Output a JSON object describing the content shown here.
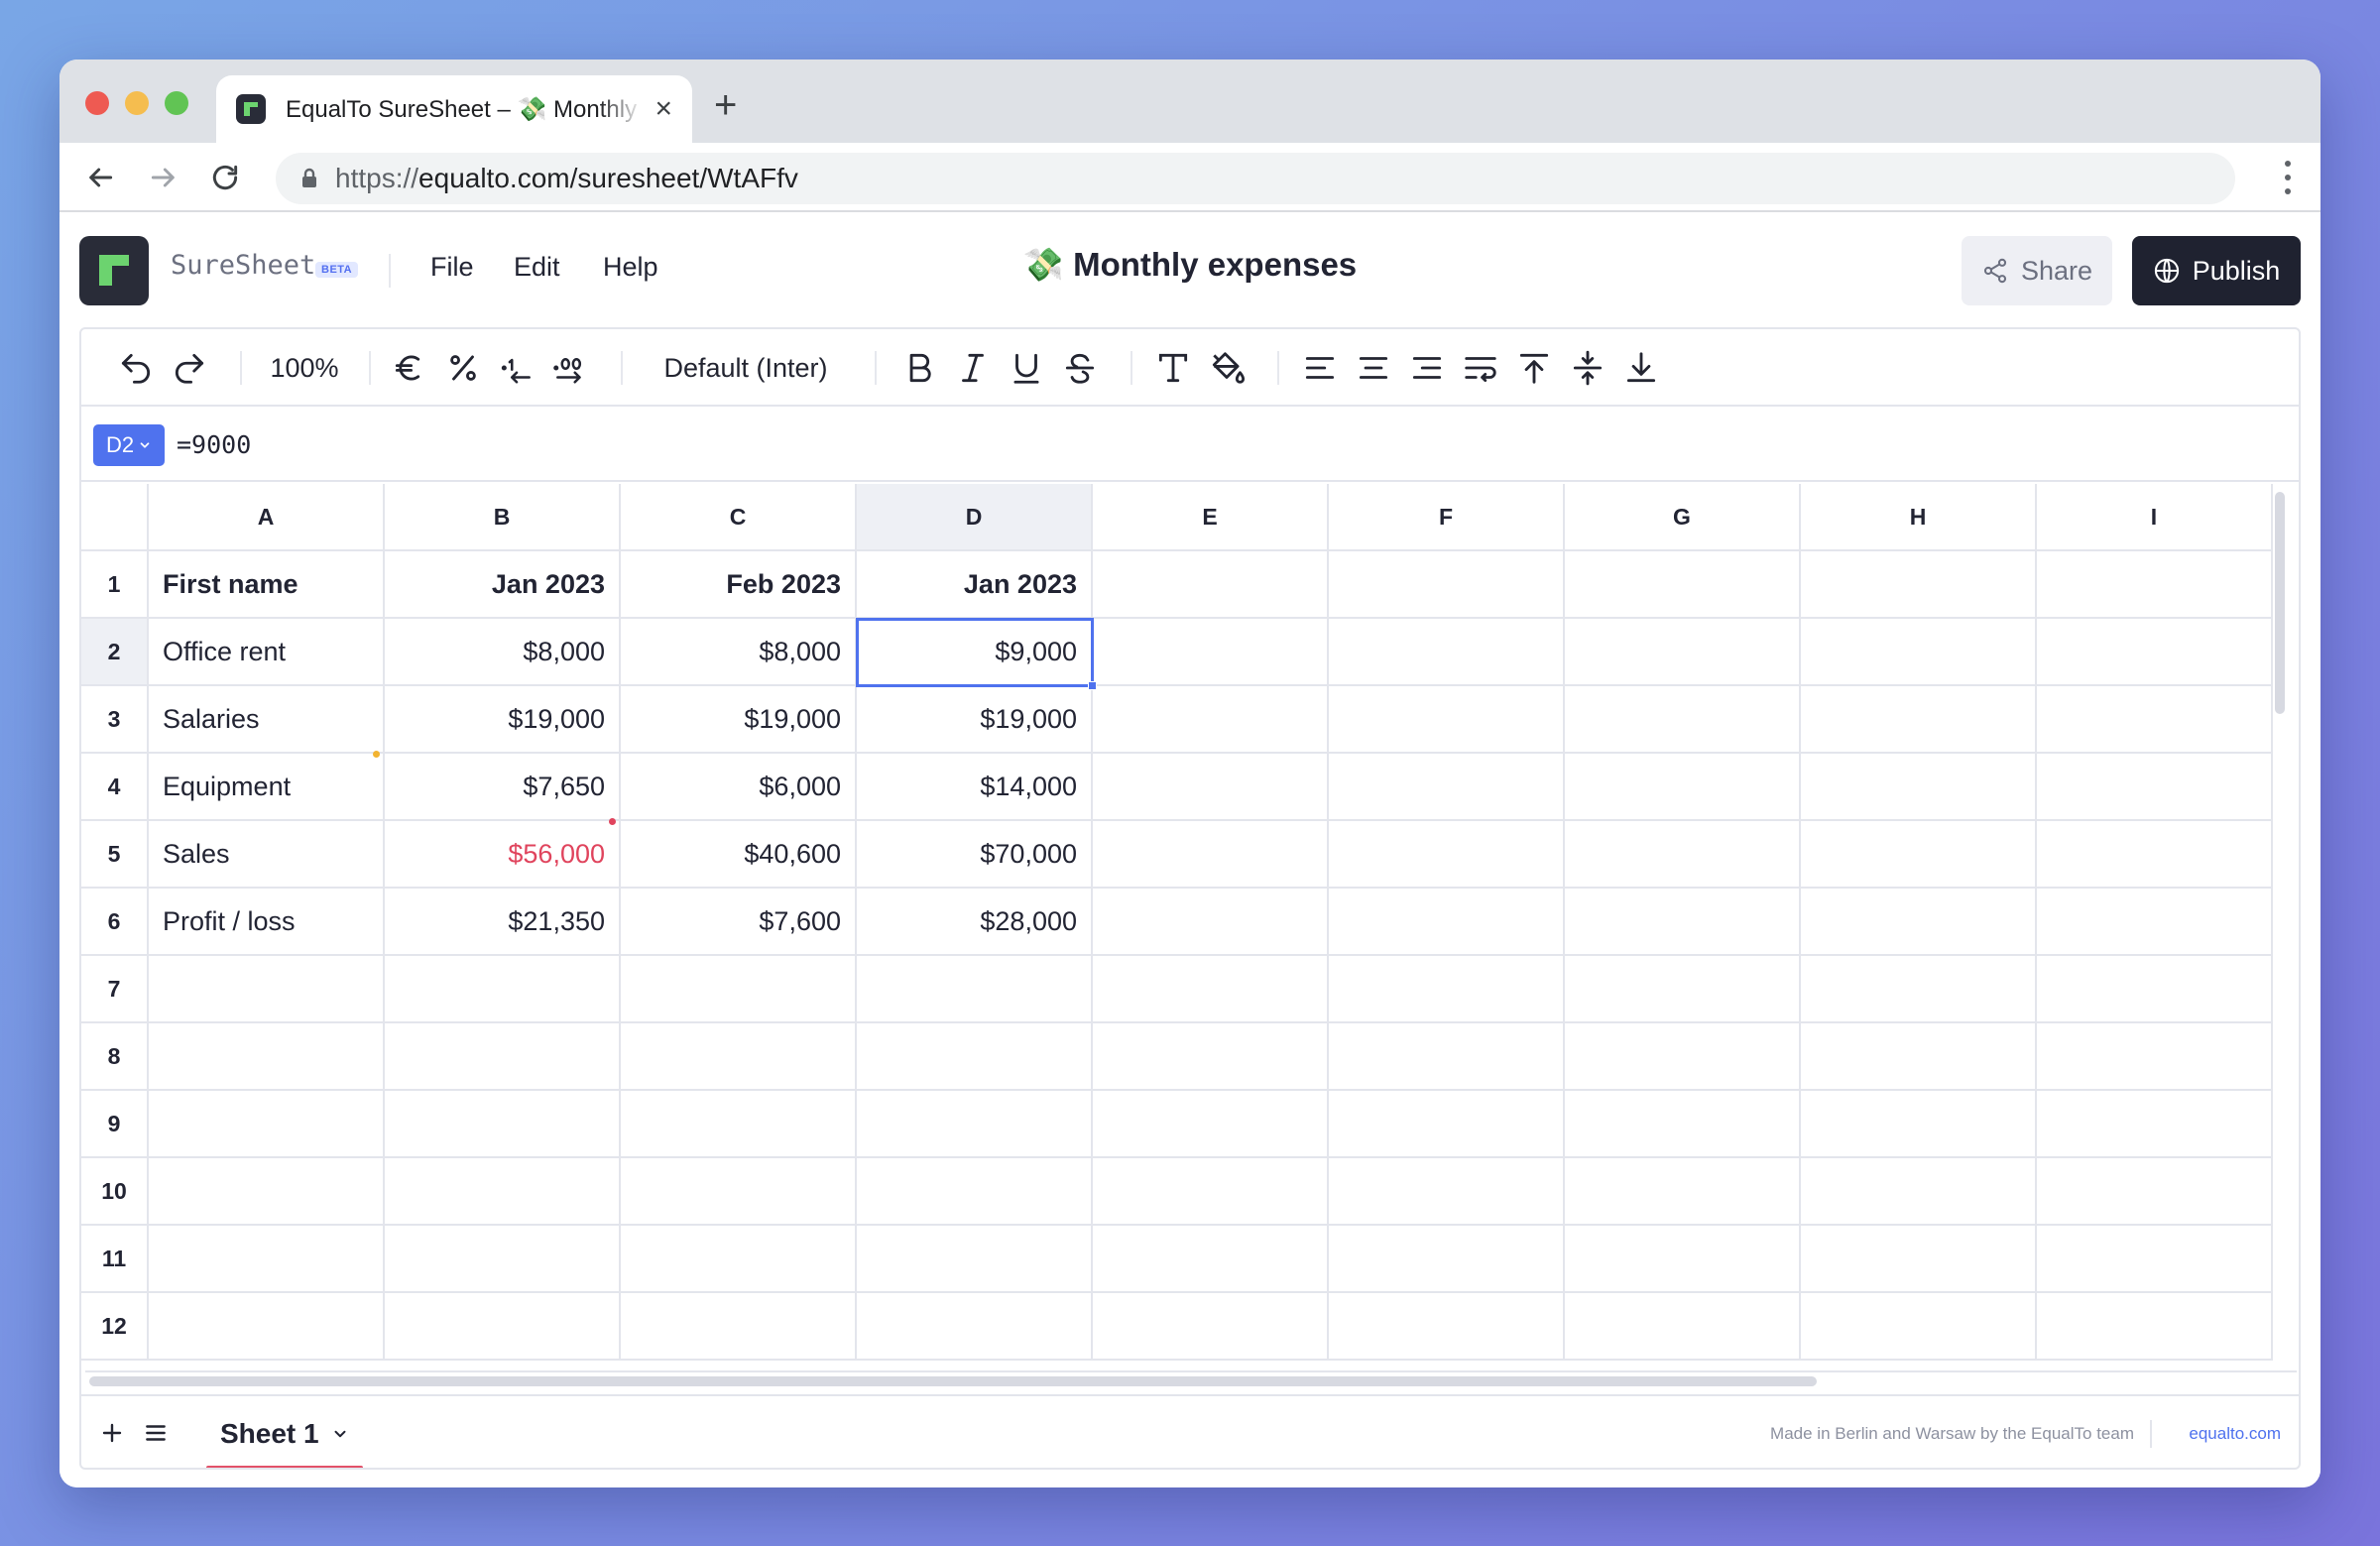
{
  "browser": {
    "tab_title": "EqualTo SureSheet – 💸 Monthly expenses",
    "url_scheme": "https://",
    "url_rest": "equalto.com/suresheet/WtAFfv"
  },
  "app": {
    "brand": "SureSheet",
    "beta": "BETA",
    "menu": {
      "file": "File",
      "edit": "Edit",
      "help": "Help"
    },
    "doc_title": "💸 Monthly expenses",
    "share_label": "Share",
    "publish_label": "Publish"
  },
  "toolbar": {
    "zoom": "100%",
    "font": "Default (Inter)"
  },
  "formula_bar": {
    "cell_ref": "D2",
    "formula": "=9000"
  },
  "grid": {
    "columns": [
      "A",
      "B",
      "C",
      "D",
      "E",
      "F",
      "G",
      "H",
      "I"
    ],
    "rows": [
      "1",
      "2",
      "3",
      "4",
      "5",
      "6",
      "7",
      "8",
      "9",
      "10",
      "11",
      "12"
    ],
    "cells": [
      [
        "First name",
        "Jan 2023",
        "Feb 2023",
        "Jan 2023"
      ],
      [
        "Office rent",
        "$8,000",
        "$8,000",
        "$9,000"
      ],
      [
        "Salaries",
        "$19,000",
        "$19,000",
        "$19,000"
      ],
      [
        "Equipment",
        "$7,650",
        "$6,000",
        "$14,000"
      ],
      [
        "Sales",
        "$56,000",
        "$40,600",
        "$70,000"
      ],
      [
        "Profit / loss",
        "$21,350",
        "$7,600",
        "$28,000"
      ]
    ],
    "selected_cell": "D2",
    "highlight_color": "#e0445d",
    "selection_color": "#4f72ee"
  },
  "footer": {
    "sheet_name": "Sheet 1",
    "made_by": "Made in Berlin and Warsaw by the EqualTo team",
    "link": "equalto.com"
  }
}
